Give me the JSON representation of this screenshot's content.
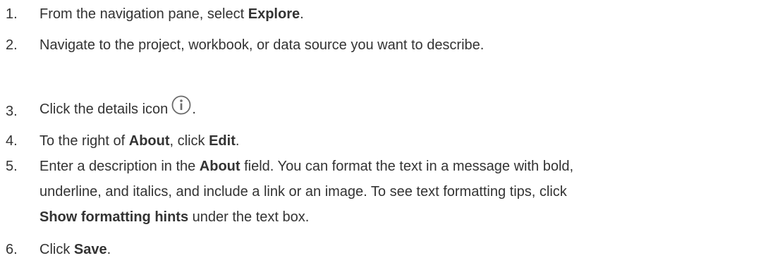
{
  "steps": [
    {
      "number": "1.",
      "before": "From the navigation pane, select ",
      "bold": "Explore",
      "after": "."
    },
    {
      "number": "2.",
      "text": "Navigate to the project, workbook, or data source you want to describe."
    },
    {
      "number": "3.",
      "before": "Click the details icon",
      "icon": "info-circle-icon",
      "after": "."
    },
    {
      "number": "4.",
      "before": "To the right of ",
      "bold1": "About",
      "middle": ", click ",
      "bold2": "Edit",
      "after": "."
    },
    {
      "number": "5.",
      "line1_before": "Enter a description in the ",
      "line1_bold": "About",
      "line1_after": " field. You can format the text in a message with bold,",
      "line2": "underline, and italics, and include a link or an image. To see text formatting tips, click",
      "line3_bold": "Show formatting hints",
      "line3_after": " under the text box."
    },
    {
      "number": "6.",
      "before": "Click ",
      "bold": "Save",
      "after": "."
    }
  ],
  "colors": {
    "text": "#333333",
    "icon": "#6b6b6b"
  }
}
